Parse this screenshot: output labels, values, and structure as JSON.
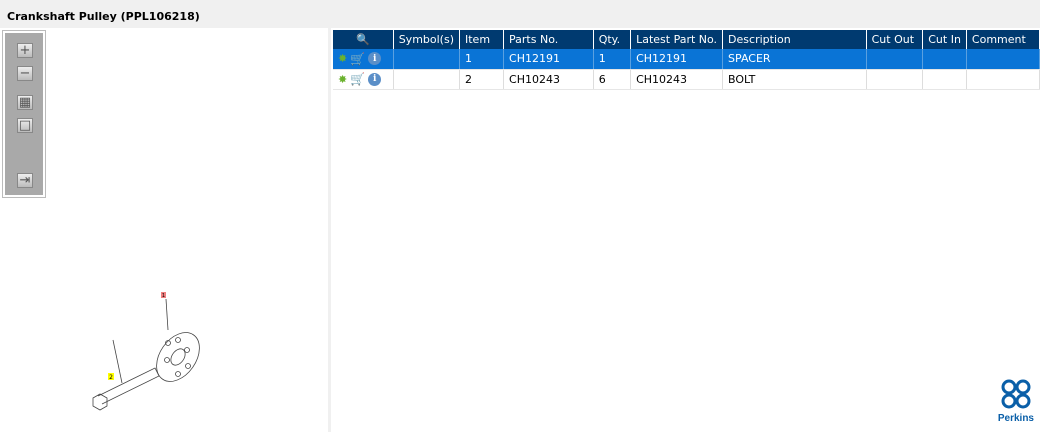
{
  "title": "Crankshaft Pulley (PPL106218)",
  "toolbar": {
    "zoom_in": "zoom-in",
    "zoom_out": "zoom-out",
    "fit": "fit",
    "actual": "actual",
    "toggle": "toggle-list"
  },
  "table": {
    "headers": [
      "",
      "Symbol(s)",
      "Item",
      "Parts No.",
      "Qty.",
      "Latest Part No.",
      "Description",
      "Cut Out",
      "Cut In",
      "Comment"
    ],
    "rows": [
      {
        "symbols": "",
        "item": "1",
        "parts_no": "CH12191",
        "qty": "1",
        "latest": "CH12191",
        "description": "SPACER",
        "cut_out": "",
        "cut_in": "",
        "comment": "",
        "selected": true
      },
      {
        "symbols": "",
        "item": "2",
        "parts_no": "CH10243",
        "qty": "6",
        "latest": "CH10243",
        "description": "BOLT",
        "cut_out": "",
        "cut_in": "",
        "comment": "",
        "selected": false
      }
    ]
  },
  "drawing": {
    "callouts": [
      "1",
      "2"
    ]
  },
  "logo": {
    "text": "Perkins"
  },
  "colors": {
    "header": "#003a70",
    "selected": "#0a74d6"
  }
}
